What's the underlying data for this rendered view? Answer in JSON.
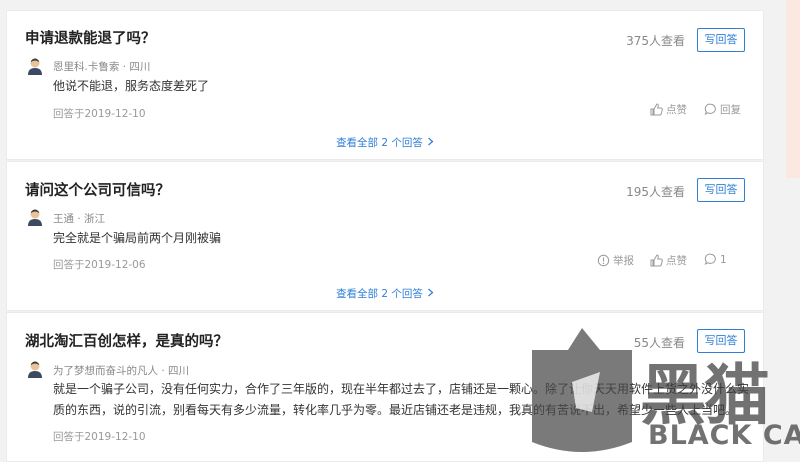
{
  "questions": [
    {
      "title": "申请退款能退了吗？",
      "views": "375人查看",
      "answer_button": "写回答",
      "answer": {
        "user": "恩里科.卡鲁索 · 四川",
        "text": "他说不能退，服务态度差死了",
        "date": "回答于2019-12-10",
        "like": "点赞",
        "reply": "回复"
      },
      "more": "查看全部 2 个回答"
    },
    {
      "title": "请问这个公司可信吗？",
      "views": "195人查看",
      "answer_button": "写回答",
      "answer": {
        "user": "王通 · 浙江",
        "text": "完全就是个骗局前两个月刚被骗",
        "date": "回答于2019-12-06",
        "report": "举报",
        "like": "点赞",
        "reply": "1"
      },
      "more": "查看全部 2 个回答"
    },
    {
      "title": "湖北淘汇百创怎样，是真的吗？",
      "views": "55人查看",
      "answer_button": "写回答",
      "answer": {
        "user": "为了梦想而奋斗的凡人 · 四川",
        "text_line1": "就是一个骗子公司，没有任何实力，合作了三年版的，现在半年都过去了，店铺还是一颗心。除了让你天天用软件上货之外没什么实",
        "text_line2": "质的东西，说的引流，别看每天有多少流量，转化率几乎为零。最近店铺还老是违规，我真的有苦说不出，希望少一些人上当吧。",
        "date": "回答于2019-12-10"
      }
    }
  ],
  "watermark": {
    "cn": "黑猫",
    "en": "BLACK CAT"
  },
  "colors": {
    "accent": "#2f7fd6",
    "muted": "#999999"
  }
}
